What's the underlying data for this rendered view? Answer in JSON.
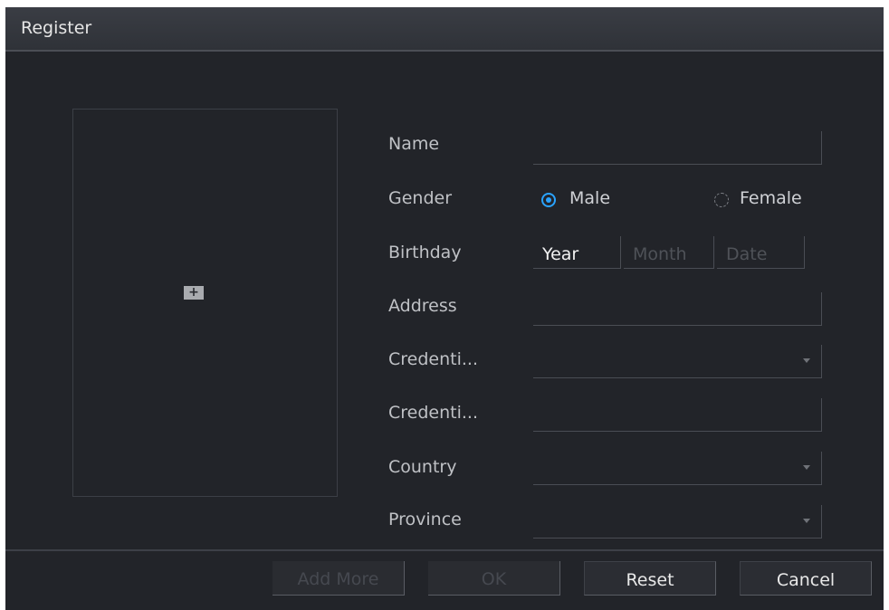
{
  "dialog": {
    "title": "Register"
  },
  "photo": {
    "add_symbol": "+"
  },
  "form": {
    "name_label": "Name",
    "name_value": "",
    "gender_label": "Gender",
    "gender_options": [
      {
        "label": "Male",
        "selected": true
      },
      {
        "label": "Female",
        "selected": false
      }
    ],
    "birthday_label": "Birthday",
    "birthday_year": "Year",
    "birthday_month": "Month",
    "birthday_date": "Date",
    "address_label": "Address",
    "address_value": "",
    "credential_type_label": "Credenti...",
    "credential_type_value": "",
    "credential_no_label": "Credenti...",
    "credential_no_value": "",
    "country_label": "Country",
    "country_value": "",
    "province_label": "Province",
    "province_value": ""
  },
  "buttons": {
    "add_more": "Add More",
    "ok": "OK",
    "reset": "Reset",
    "cancel": "Cancel"
  },
  "colors": {
    "accent": "#2aa3ff",
    "background": "#222429"
  }
}
